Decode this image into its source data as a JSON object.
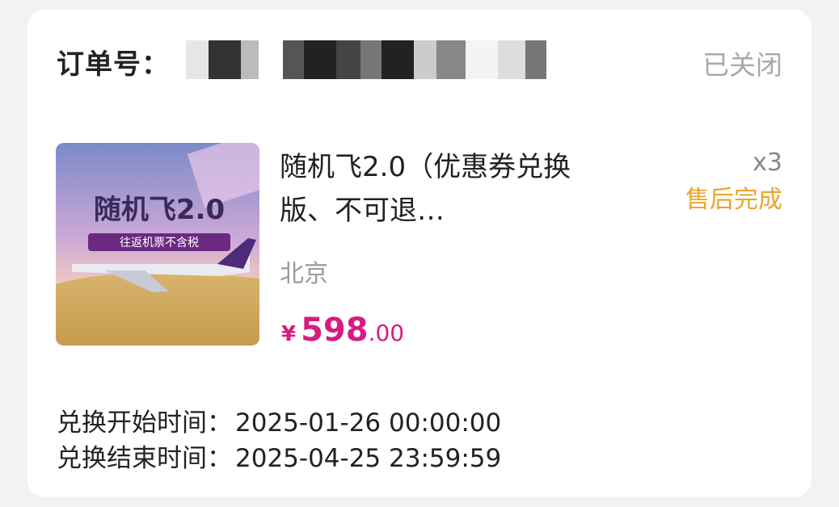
{
  "order": {
    "label": "订单号：",
    "status": "已关闭"
  },
  "product": {
    "image_alt": "随机飞2.0 往返机票不含税",
    "image_title": "随机飞2.0",
    "image_subtitle": "往返机票不含税",
    "title": "随机飞2.0（优惠券兑换版、不可退…",
    "quantity": "x3",
    "after_sale_status": "售后完成",
    "city": "北京",
    "price_currency": "¥",
    "price_integer": "598",
    "price_decimal": ".00"
  },
  "exchange": {
    "start_label": "兑换开始时间：",
    "start_value": "2025-01-26 00:00:00",
    "end_label": "兑换结束时间：",
    "end_value": "2025-04-25 23:59:59"
  },
  "colors": {
    "price": "#d81b82",
    "after_sale": "#e8a52b",
    "status": "#a9a9a9"
  }
}
